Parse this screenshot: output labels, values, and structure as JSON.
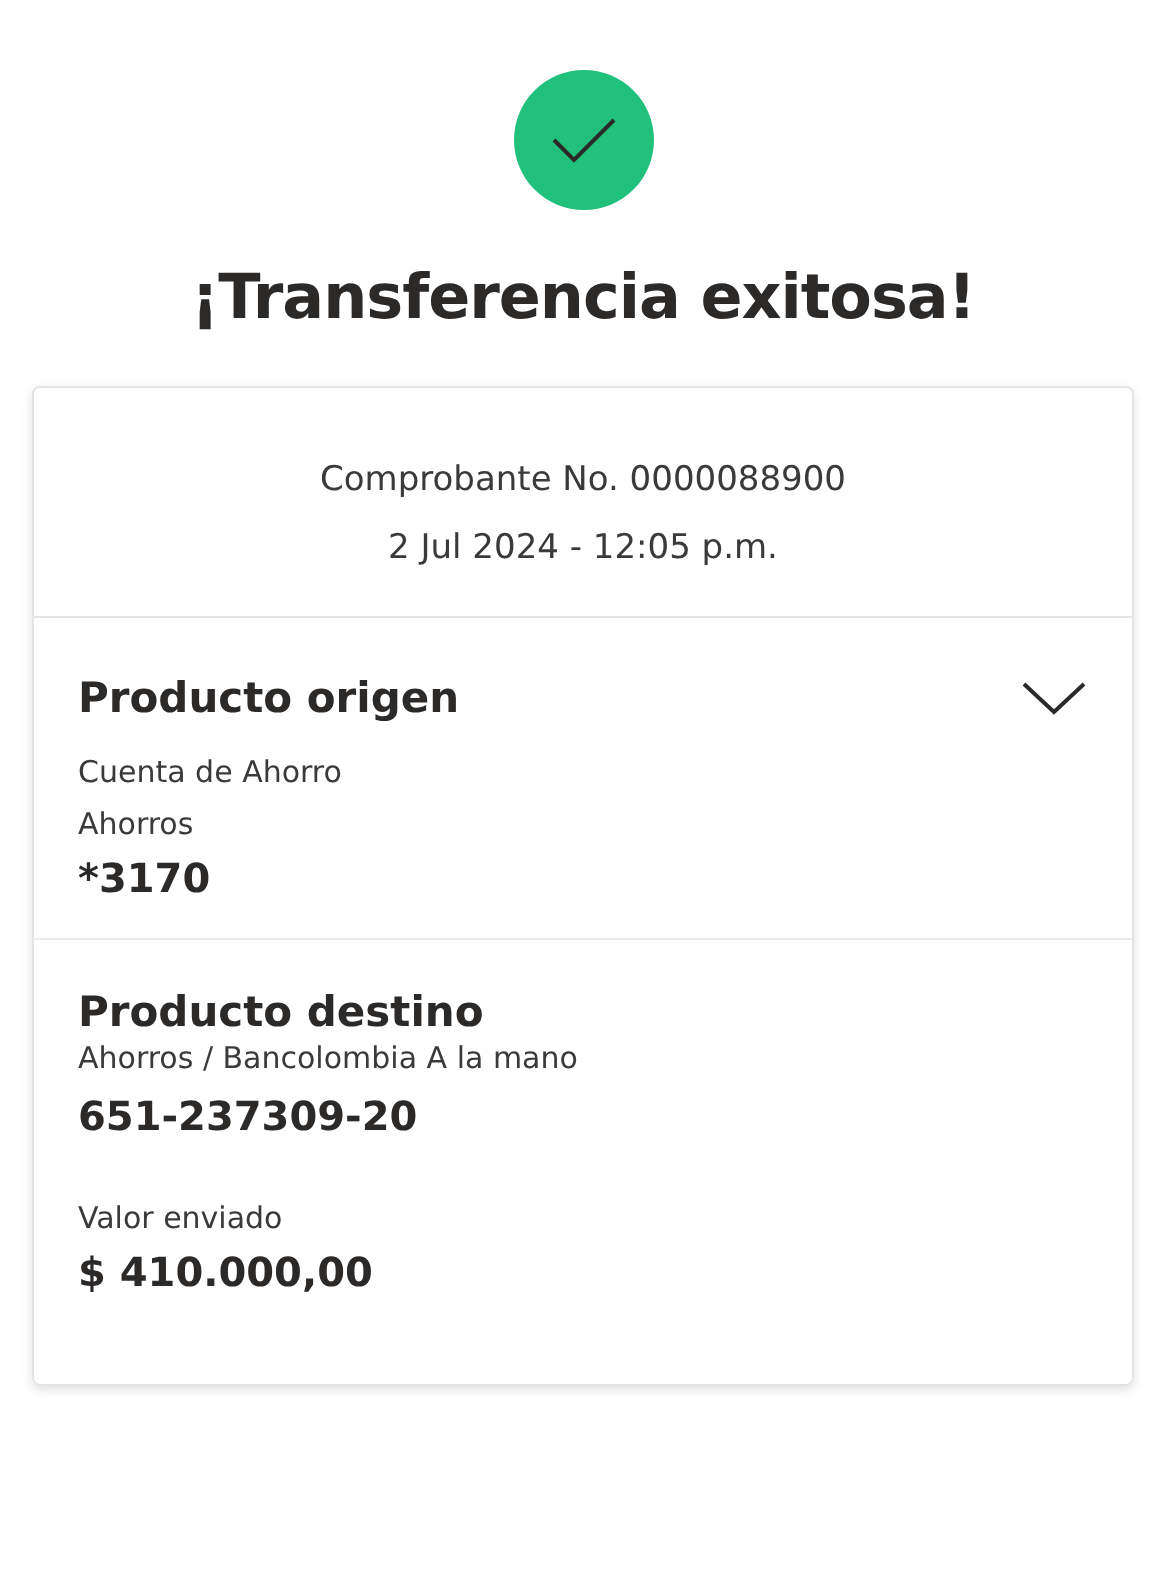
{
  "title": "¡Transferencia exitosa!",
  "receipt": {
    "number": "Comprobante No. 0000088900",
    "datetime": "2 Jul 2024 - 12:05 p.m."
  },
  "origin": {
    "heading": "Producto origen",
    "expanded": false,
    "account_type": "Cuenta de Ahorro",
    "account_name": "Ahorros",
    "account_number": "*3170"
  },
  "destination": {
    "heading": "Producto destino",
    "account_name": "Ahorros / Bancolombia A la mano",
    "account_number": "651-237309-20",
    "amount_label": "Valor enviado",
    "amount": "$ 410.000,00"
  }
}
